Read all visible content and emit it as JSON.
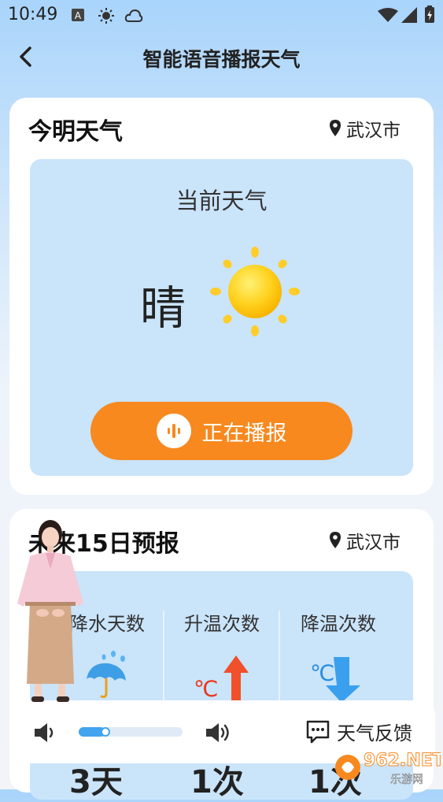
{
  "status_bar": {
    "time": "10:49"
  },
  "header": {
    "title": "智能语音播报天气"
  },
  "today_card": {
    "title": "今明天气",
    "location": "武汉市",
    "current_label": "当前天气",
    "condition": "晴",
    "play_button_label": "正在播报"
  },
  "forecast_card": {
    "title": "未来15日预报",
    "location": "武汉市",
    "stats": [
      {
        "label": "降水天数",
        "value": "3天"
      },
      {
        "label": "升温次数",
        "value": "1次"
      },
      {
        "label": "降温次数",
        "value": "1次"
      }
    ]
  },
  "player": {
    "volume_level": 0.26,
    "feedback_label": "天气反馈"
  },
  "watermark": {
    "text": "962.NET",
    "subtext": "乐游网"
  },
  "colors": {
    "accent_orange": "#f7891f",
    "accent_blue": "#42a4ee",
    "panel_blue": "#cae4fa"
  }
}
